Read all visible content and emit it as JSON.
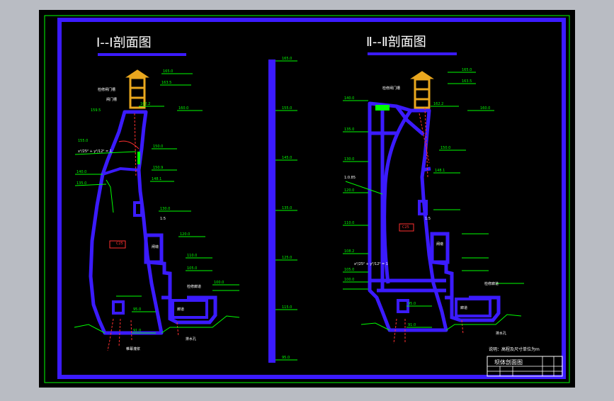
{
  "drawing": {
    "section1_title": "Ⅰ--Ⅰ剖面图",
    "section2_title": "Ⅱ--Ⅱ剖面图",
    "note": "说明：高程及尺寸单位为m",
    "title_block_name": "坝体剖面图"
  },
  "labels": {
    "left": {
      "trash_rack": "检修闸门槽",
      "gate_slot": "闸门槽",
      "gallery": "廊道",
      "inspection_gallery": "检修廊道",
      "grout_curtain": "帷幕灌浆",
      "drain_hole": "排水孔",
      "concrete": "C25",
      "wall": "闸墩",
      "ratio": "1:5",
      "formula": "x²/25² + y²/12² = 1"
    },
    "right": {
      "trash_rack": "检修闸门槽",
      "gallery": "廊道",
      "inspection_gallery": "检修廊道",
      "drain_hole": "排水孔",
      "concrete": "C25",
      "wall": "闸墩",
      "ratio": "1:5",
      "formula": "x²/25² + y²/12² = 1",
      "slope": "1:0.85"
    }
  },
  "elevations": {
    "left": [
      "165.0",
      "163.5",
      "162.2",
      "160.0",
      "159.5",
      "155.0",
      "150.9",
      "150.0",
      "148.1",
      "140.0",
      "135.0",
      "130.0",
      "120.0",
      "110.0",
      "105.0",
      "100.0",
      "95.0",
      "91.0"
    ],
    "center_scale": [
      "165.0",
      "155.0",
      "145.0",
      "135.0",
      "125.0",
      "115.0",
      "105.0",
      "95.0"
    ],
    "right": [
      "165.0",
      "163.5",
      "162.2",
      "160.0",
      "150.0",
      "148.1",
      "140.0",
      "135.0",
      "130.0",
      "120.0",
      "110.0",
      "108.2",
      "105.0",
      "100.0",
      "95.0",
      "91.0"
    ]
  }
}
